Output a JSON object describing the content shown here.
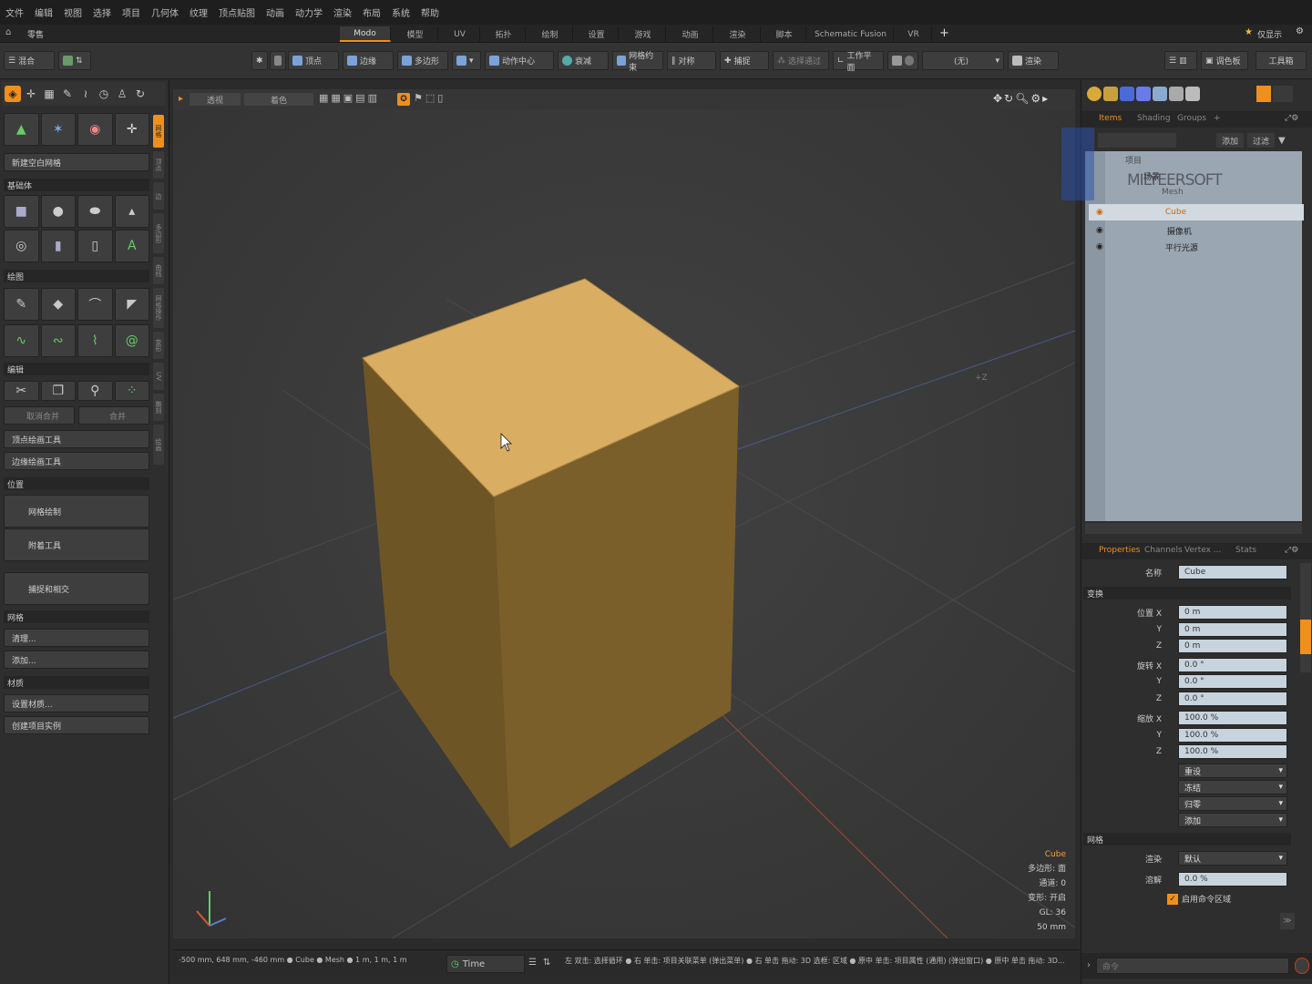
{
  "menu": [
    "文件",
    "编辑",
    "视图",
    "选择",
    "项目",
    "几何体",
    "纹理",
    "顶点贴图",
    "动画",
    "动力学",
    "渲染",
    "布局",
    "系统",
    "帮助"
  ],
  "layout_tabs": {
    "left_label": "零售",
    "tabs": [
      "Modo",
      "模型",
      "UV",
      "拓扑",
      "绘制",
      "设置",
      "游戏",
      "动画",
      "渲染",
      "脚本",
      "Schematic Fusion",
      "VR"
    ],
    "add": "+",
    "right_label": "仅显示"
  },
  "toolbar": {
    "left": "混合",
    "items": [
      "顶点",
      "边缘",
      "多边形",
      "动作中心",
      "衰减",
      "网格约束",
      "对称",
      "捕捉",
      "选择通过",
      "工作平面"
    ],
    "dropdown_value": "(无)",
    "render": "渲染",
    "palette": "调色板",
    "toolbox": "工具箱"
  },
  "left_panel": {
    "vertical_tabs": [
      "网格",
      "顶点",
      "边",
      "多边形",
      "曲线",
      "网格操作",
      "变形",
      "UV",
      "雕刻",
      "绘画"
    ],
    "new_mesh": "新建空白网格",
    "sections": {
      "primitives": "基础体",
      "curves": "绘图",
      "edit": "编辑",
      "position": "位置",
      "mesh": "网格",
      "material": "材质"
    },
    "edit_buttons": [
      "取消合并",
      "合并"
    ],
    "vertex_tool": "顶点绘画工具",
    "edge_tool": "边缘绘画工具",
    "mesh_paint": "网格绘制",
    "attach_tool": "附着工具",
    "snap": "捕捉和相交",
    "mesh_cleanup": "清理...",
    "mesh_add": "添加...",
    "set_material": "设置材质...",
    "create_item": "创建项目实例"
  },
  "viewport": {
    "chips": [
      "透视",
      "着色"
    ],
    "axis_z": "+Z",
    "info": {
      "name": "Cube",
      "polys": "多边形: 面",
      "channels": "通道: 0",
      "deformers": "变形: 开启",
      "gl": "GL: 36",
      "size": "50 mm"
    },
    "colors": {
      "cube_top": "#d9ad62",
      "cube_left": "#6e5526",
      "cube_right": "#7a5f2b",
      "bg": "#3c3c3c"
    }
  },
  "status": {
    "coords": "-500 mm, 648 mm, -460 mm ● Cube ● Mesh ● 1 m, 1 m, 1 m",
    "time": "Time",
    "hint": "左 双击: 选择循环 ● 右 单击: 项目关联菜单 (弹出菜单) ● 右 单击 拖动: 3D 选框: 区域 ● 原中 单击: 项目属性 (通用) (弹出窗口) ● 原中 单击 拖动: 3D..."
  },
  "scene": {
    "tabs": [
      "Items",
      "Shading",
      "Groups"
    ],
    "add_btn": "添加",
    "filter_btn": "过滤",
    "items": [
      "项目",
      "场景",
      "Mesh",
      "Cube",
      "摄像机",
      "平行光源"
    ],
    "watermark": "MILYEERSOFT"
  },
  "properties": {
    "tabs": [
      "Properties",
      "Channels",
      "Vertex ...",
      "Stats"
    ],
    "name_label": "名称",
    "name_value": "Cube",
    "transform": "变换",
    "pos_label": "位置 X",
    "rot_label": "旋转 X",
    "scale_label": "缩放 X",
    "y": "Y",
    "z": "Z",
    "pos": [
      "0 m",
      "0 m",
      "0 m"
    ],
    "rot": [
      "0.0 °",
      "0.0 °",
      "0.0 °"
    ],
    "scale": [
      "100.0 %",
      "100.0 %",
      "100.0 %"
    ],
    "dropdowns": [
      "重设",
      "冻结",
      "归零",
      "添加"
    ],
    "mesh_section": "网格",
    "render_label": "渲染",
    "render_value": "默认",
    "dissolve_label": "溶解",
    "dissolve_value": "0.0 %",
    "checkbox_label": "启用命令区域",
    "command_placeholder": "命令"
  }
}
